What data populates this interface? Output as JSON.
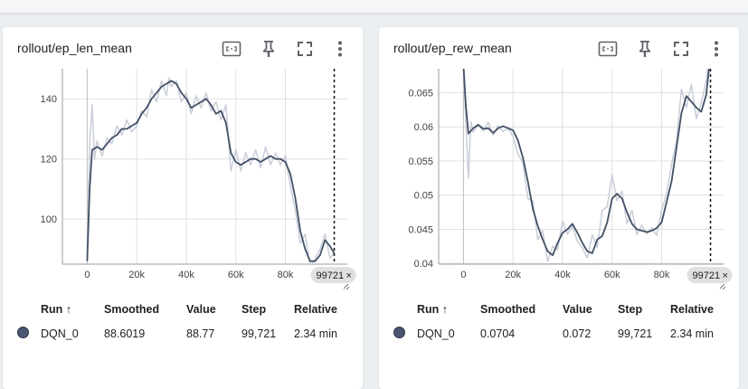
{
  "cards": [
    {
      "title": "rollout/ep_len_mean",
      "icons": [
        "fit-domain-icon",
        "pin-icon",
        "fullscreen-icon",
        "more-vert-icon"
      ],
      "chart_data": {
        "type": "line",
        "title": "rollout/ep_len_mean",
        "xlabel": "",
        "ylabel": "",
        "xlim": [
          -10000,
          105000
        ],
        "ylim": [
          85,
          150
        ],
        "xticks": [
          0,
          20000,
          40000,
          60000,
          80000
        ],
        "xtick_labels": [
          "0",
          "20k",
          "40k",
          "60k",
          "80k"
        ],
        "yticks": [
          100,
          120,
          140
        ],
        "ytick_labels": [
          "100",
          "120",
          "140"
        ],
        "grid": true,
        "cursor_step": 99721,
        "cursor_label": "99721",
        "series": [
          {
            "name": "DQN_0 (smoothed)",
            "color": "#425066",
            "x": [
              0,
              1000,
              2000,
              4000,
              6000,
              8000,
              10000,
              12000,
              14000,
              16000,
              18000,
              20000,
              22000,
              24000,
              26000,
              28000,
              30000,
              32000,
              34000,
              36000,
              38000,
              40000,
              42000,
              44000,
              46000,
              48000,
              50000,
              52000,
              54000,
              56000,
              58000,
              60000,
              62000,
              64000,
              66000,
              68000,
              70000,
              72000,
              74000,
              76000,
              78000,
              80000,
              82000,
              84000,
              86000,
              88000,
              90000,
              92000,
              94000,
              96000,
              98000,
              99721
            ],
            "y": [
              86,
              110,
              123,
              124,
              123,
              125,
              127,
              128,
              130,
              130,
              131,
              132,
              135,
              137,
              140,
              142,
              144,
              145,
              146,
              145,
              142,
              140,
              137,
              138,
              139,
              140,
              138,
              135,
              136,
              132,
              122,
              119,
              118,
              119,
              120,
              120,
              119,
              120,
              121,
              120,
              120,
              119,
              115,
              107,
              96,
              90,
              86,
              86,
              88,
              93,
              91,
              88.6
            ]
          },
          {
            "name": "DQN_0",
            "color": "#c9ced8",
            "x": [
              0,
              1000,
              2000,
              3000,
              4000,
              6000,
              8000,
              10000,
              12000,
              14000,
              16000,
              18000,
              20000,
              22000,
              24000,
              26000,
              28000,
              30000,
              32000,
              33000,
              34000,
              36000,
              38000,
              40000,
              42000,
              44000,
              46000,
              48000,
              50000,
              52000,
              54000,
              56000,
              58000,
              60000,
              62000,
              64000,
              66000,
              68000,
              70000,
              72000,
              74000,
              76000,
              78000,
              80000,
              82000,
              84000,
              86000,
              88000,
              90000,
              92000,
              94000,
              96000,
              98000,
              99721
            ],
            "y": [
              86,
              125,
              138,
              120,
              126,
              121,
              127,
              125,
              131,
              128,
              133,
              129,
              131,
              136,
              134,
              143,
              139,
              146,
              141,
              147,
              144,
              146,
              139,
              142,
              135,
              141,
              137,
              142,
              136,
              139,
              133,
              138,
              116,
              123,
              116,
              122,
              118,
              123,
              117,
              124,
              118,
              122,
              118,
              121,
              111,
              103,
              92,
              95,
              84,
              87,
              90,
              95,
              87,
              88.77
            ]
          }
        ]
      },
      "legend": {
        "headers": {
          "run": "Run ↑",
          "smoothed": "Smoothed",
          "value": "Value",
          "step": "Step",
          "relative": "Relative"
        },
        "rows": [
          {
            "color": "#4a5670",
            "run": "DQN_0",
            "smoothed": "88.6019",
            "value": "88.77",
            "step": "99,721",
            "relative": "2.34 min"
          }
        ]
      }
    },
    {
      "title": "rollout/ep_rew_mean",
      "icons": [
        "fit-domain-icon",
        "pin-icon",
        "fullscreen-icon",
        "more-vert-icon"
      ],
      "chart_data": {
        "type": "line",
        "title": "rollout/ep_rew_mean",
        "xlabel": "",
        "ylabel": "",
        "xlim": [
          -10000,
          105000
        ],
        "ylim": [
          0.0399,
          0.0685
        ],
        "xticks": [
          0,
          20000,
          40000,
          60000,
          80000
        ],
        "xtick_labels": [
          "0",
          "20k",
          "40k",
          "60k",
          "80k"
        ],
        "yticks": [
          0.04,
          0.045,
          0.05,
          0.055,
          0.06,
          0.065
        ],
        "ytick_labels": [
          "0.04",
          "0.045",
          "0.05",
          "0.055",
          "0.06",
          "0.065"
        ],
        "grid": true,
        "cursor_step": 99721,
        "cursor_label": "99721",
        "series": [
          {
            "name": "DQN_0 (smoothed)",
            "color": "#425066",
            "x": [
              0,
              1000,
              2000,
              4000,
              6000,
              8000,
              10000,
              12000,
              14000,
              16000,
              18000,
              20000,
              22000,
              24000,
              26000,
              28000,
              30000,
              32000,
              34000,
              36000,
              38000,
              40000,
              42000,
              44000,
              46000,
              48000,
              50000,
              52000,
              54000,
              56000,
              58000,
              60000,
              62000,
              64000,
              66000,
              68000,
              70000,
              72000,
              74000,
              76000,
              78000,
              80000,
              82000,
              84000,
              86000,
              88000,
              90000,
              92000,
              94000,
              96000,
              98000,
              99721
            ],
            "y": [
              0.069,
              0.063,
              0.059,
              0.0598,
              0.0603,
              0.0597,
              0.0598,
              0.0591,
              0.0598,
              0.0601,
              0.0598,
              0.0595,
              0.058,
              0.0555,
              0.052,
              0.048,
              0.0455,
              0.0435,
              0.0418,
              0.0412,
              0.043,
              0.0445,
              0.045,
              0.0458,
              0.0445,
              0.043,
              0.0418,
              0.0415,
              0.0435,
              0.044,
              0.046,
              0.0495,
              0.0502,
              0.0495,
              0.0475,
              0.0458,
              0.045,
              0.0448,
              0.0446,
              0.0448,
              0.0452,
              0.046,
              0.049,
              0.052,
              0.057,
              0.062,
              0.0645,
              0.0637,
              0.0628,
              0.0622,
              0.0647,
              0.0704
            ]
          },
          {
            "name": "DQN_0",
            "color": "#c9ced8",
            "x": [
              0,
              1000,
              2000,
              3000,
              4000,
              6000,
              8000,
              10000,
              12000,
              14000,
              16000,
              18000,
              20000,
              22000,
              24000,
              26000,
              28000,
              30000,
              32000,
              34000,
              36000,
              38000,
              40000,
              42000,
              44000,
              46000,
              48000,
              50000,
              52000,
              54000,
              56000,
              58000,
              60000,
              62000,
              64000,
              66000,
              68000,
              70000,
              72000,
              74000,
              76000,
              78000,
              80000,
              82000,
              84000,
              86000,
              88000,
              90000,
              92000,
              94000,
              96000,
              98000,
              99721
            ],
            "y": [
              0.069,
              0.0605,
              0.0525,
              0.0608,
              0.0592,
              0.0603,
              0.0594,
              0.0607,
              0.0588,
              0.0602,
              0.0593,
              0.0598,
              0.0586,
              0.056,
              0.0548,
              0.0495,
              0.0492,
              0.0435,
              0.0448,
              0.0403,
              0.0425,
              0.042,
              0.0462,
              0.0443,
              0.0455,
              0.0432,
              0.0423,
              0.0408,
              0.0442,
              0.0423,
              0.0478,
              0.0483,
              0.053,
              0.0492,
              0.0506,
              0.0458,
              0.0478,
              0.0442,
              0.0456,
              0.0443,
              0.0452,
              0.0441,
              0.0478,
              0.0502,
              0.0545,
              0.058,
              0.0655,
              0.0628,
              0.0662,
              0.0612,
              0.0635,
              0.0668,
              0.072
            ]
          }
        ]
      },
      "legend": {
        "headers": {
          "run": "Run ↑",
          "smoothed": "Smoothed",
          "value": "Value",
          "step": "Step",
          "relative": "Relative"
        },
        "rows": [
          {
            "color": "#4a5670",
            "run": "DQN_0",
            "smoothed": "0.0704",
            "value": "0.072",
            "step": "99,721",
            "relative": "2.34 min"
          }
        ]
      }
    }
  ]
}
